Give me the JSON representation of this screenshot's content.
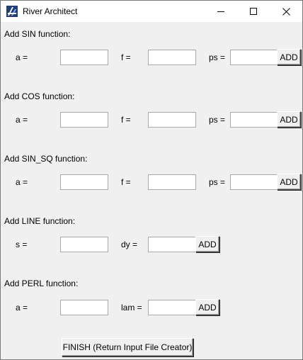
{
  "window": {
    "title": "River Architect",
    "minimize_icon": "minimize-icon",
    "maximize_icon": "maximize-icon",
    "close_icon": "close-icon",
    "app_icon": "river-architect-logo-icon"
  },
  "sections": {
    "sin": {
      "heading": "Add SIN function:",
      "label_a": "a =",
      "label_f": "f =",
      "label_ps": "ps =",
      "value_a": "",
      "value_f": "",
      "value_ps": "",
      "add_label": "ADD"
    },
    "cos": {
      "heading": "Add COS function:",
      "label_a": "a =",
      "label_f": "f =",
      "label_ps": "ps =",
      "value_a": "",
      "value_f": "",
      "value_ps": "",
      "add_label": "ADD"
    },
    "sin_sq": {
      "heading": "Add SIN_SQ function:",
      "label_a": "a =",
      "label_f": "f =",
      "label_ps": "ps =",
      "value_a": "",
      "value_f": "",
      "value_ps": "",
      "add_label": "ADD"
    },
    "line": {
      "heading": "Add LINE function:",
      "label_s": "s =",
      "label_dy": "dy =",
      "value_s": "",
      "value_dy": "",
      "add_label": "ADD"
    },
    "perl": {
      "heading": "Add PERL function:",
      "label_a": "a =",
      "label_lam": "lam =",
      "value_a": "",
      "value_lam": "",
      "add_label": "ADD"
    }
  },
  "finish_label": "FINISH (Return Input File Creator)"
}
